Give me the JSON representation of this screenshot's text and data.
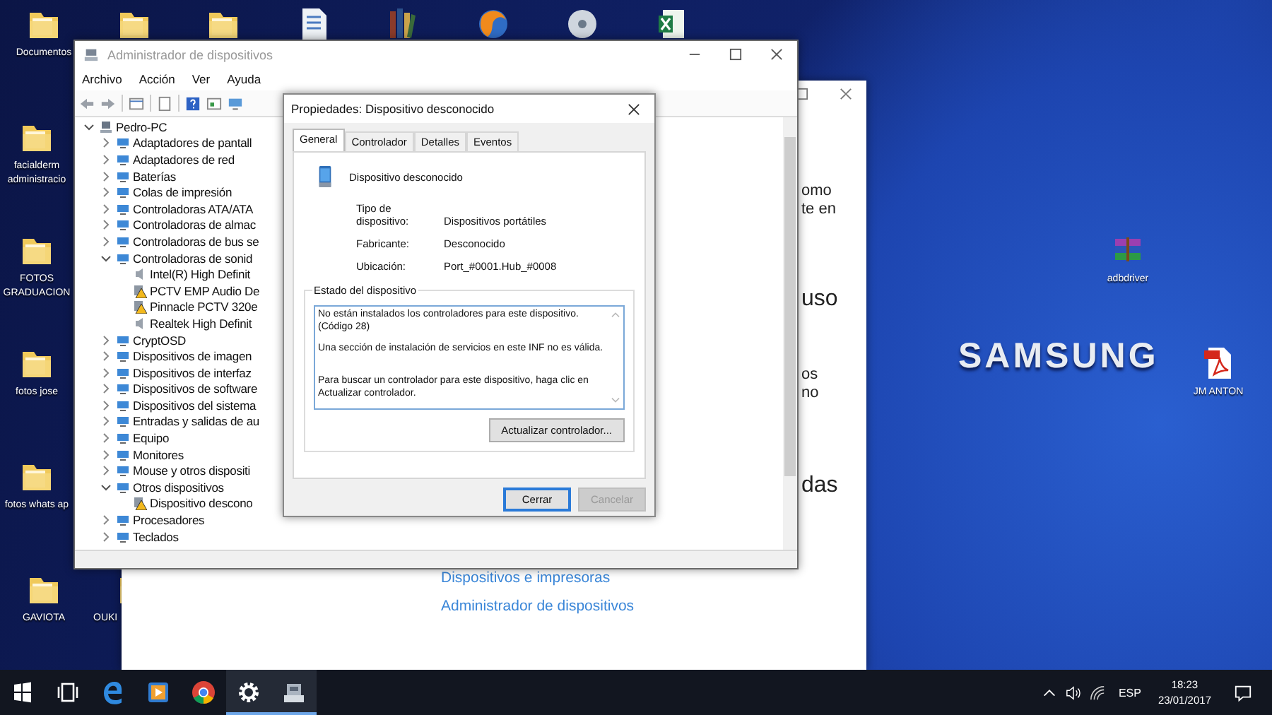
{
  "desktop": {
    "wallpaper_logo": "SAMSUNG",
    "icons": [
      {
        "kind": "folder",
        "lines": [
          "Documentos"
        ]
      },
      {
        "kind": "folder"
      },
      {
        "kind": "folder"
      },
      {
        "kind": "document"
      },
      {
        "kind": "books"
      },
      {
        "kind": "browser"
      },
      {
        "kind": "disc"
      },
      {
        "kind": "spreadsheet"
      },
      {
        "kind": "folder",
        "lines": [
          "facialderm",
          "administracio"
        ]
      },
      {
        "kind": "folder",
        "lines": [
          "FOTOS",
          "GRADUACION"
        ]
      },
      {
        "kind": "folder",
        "lines": [
          "fotos jose"
        ]
      },
      {
        "kind": "folder",
        "lines": [
          "fotos whats ap"
        ]
      },
      {
        "kind": "folder",
        "lines": [
          "GAVIOTA"
        ]
      },
      {
        "kind": "folder",
        "lines": [
          "OUKI"
        ]
      },
      {
        "kind": "archive",
        "lines": [
          "adbdriver"
        ]
      },
      {
        "kind": "pdf",
        "lines": [
          "JM ANTON"
        ]
      }
    ]
  },
  "settings_window": {
    "fragments": [
      {
        "kind": "body",
        "lines": [
          "omo",
          "te en"
        ]
      },
      {
        "kind": "heading",
        "lines": [
          "uso"
        ]
      },
      {
        "kind": "body",
        "lines": [
          "os",
          "no"
        ]
      },
      {
        "kind": "heading",
        "lines": [
          "das"
        ]
      }
    ],
    "links": [
      "Dispositivos e impresoras",
      "Administrador de dispositivos"
    ]
  },
  "device_manager": {
    "title": "Administrador de dispositivos",
    "menu": [
      "Archivo",
      "Acción",
      "Ver",
      "Ayuda"
    ],
    "tree": [
      {
        "label": "Pedro-PC",
        "expanded": true,
        "children": [
          {
            "label": "Adaptadores de pantall",
            "expanded": false
          },
          {
            "label": "Adaptadores de red",
            "expanded": false
          },
          {
            "label": "Baterías",
            "expanded": false
          },
          {
            "label": "Colas de impresión",
            "expanded": false
          },
          {
            "label": "Controladoras ATA/ATA",
            "expanded": false
          },
          {
            "label": "Controladoras de almac",
            "expanded": false
          },
          {
            "label": "Controladoras de bus se",
            "expanded": false
          },
          {
            "label": "Controladoras de sonid",
            "expanded": true,
            "children": [
              {
                "label": "Intel(R) High Definit",
                "warning": false
              },
              {
                "label": "PCTV EMP Audio De",
                "warning": true
              },
              {
                "label": "Pinnacle PCTV 320e",
                "warning": true
              },
              {
                "label": "Realtek High Definit",
                "warning": false
              }
            ]
          },
          {
            "label": "CryptOSD",
            "expanded": false
          },
          {
            "label": "Dispositivos de imagen",
            "expanded": false
          },
          {
            "label": "Dispositivos de interfaz",
            "expanded": false
          },
          {
            "label": "Dispositivos de software",
            "expanded": false
          },
          {
            "label": "Dispositivos del sistema",
            "expanded": false
          },
          {
            "label": "Entradas y salidas de au",
            "expanded": false
          },
          {
            "label": "Equipo",
            "expanded": false
          },
          {
            "label": "Monitores",
            "expanded": false
          },
          {
            "label": "Mouse y otros dispositi",
            "expanded": false
          },
          {
            "label": "Otros dispositivos",
            "expanded": true,
            "children": [
              {
                "label": "Dispositivo descono",
                "warning": true
              }
            ]
          },
          {
            "label": "Procesadores",
            "expanded": false
          },
          {
            "label": "Teclados",
            "expanded": false
          }
        ]
      }
    ]
  },
  "properties_dialog": {
    "title": "Propiedades: Dispositivo desconocido",
    "tabs": [
      {
        "label": "General",
        "selected": true
      },
      {
        "label": "Controlador",
        "selected": false
      },
      {
        "label": "Detalles",
        "selected": false
      },
      {
        "label": "Eventos",
        "selected": false
      }
    ],
    "device_name": "Dispositivo desconocido",
    "fields": [
      {
        "label": "Tipo de dispositivo:",
        "value": "Dispositivos portátiles"
      },
      {
        "label": "Fabricante:",
        "value": "Desconocido"
      },
      {
        "label": "Ubicación:",
        "value": "Port_#0001.Hub_#0008"
      }
    ],
    "status_group": "Estado del dispositivo",
    "status_messages": [
      "No están instalados los controladores para este dispositivo. (Código 28)",
      "Una sección de instalación de servicios en este INF no es válida.",
      "Para buscar un controlador para este dispositivo, haga clic en Actualizar controlador."
    ],
    "update_button": "Actualizar controlador...",
    "buttons": [
      {
        "label": "Cerrar",
        "default": true,
        "disabled": false
      },
      {
        "label": "Cancelar",
        "default": false,
        "disabled": true
      }
    ]
  },
  "taskbar": {
    "apps": [
      {
        "kind": "task_view",
        "active": false
      },
      {
        "kind": "edge",
        "active": false
      },
      {
        "kind": "media",
        "active": false
      },
      {
        "kind": "chrome",
        "active": false
      },
      {
        "kind": "settings",
        "active": true
      },
      {
        "kind": "device_manager",
        "active": true
      }
    ],
    "language": "ESP",
    "time": "18:23",
    "date": "23/01/2017"
  }
}
